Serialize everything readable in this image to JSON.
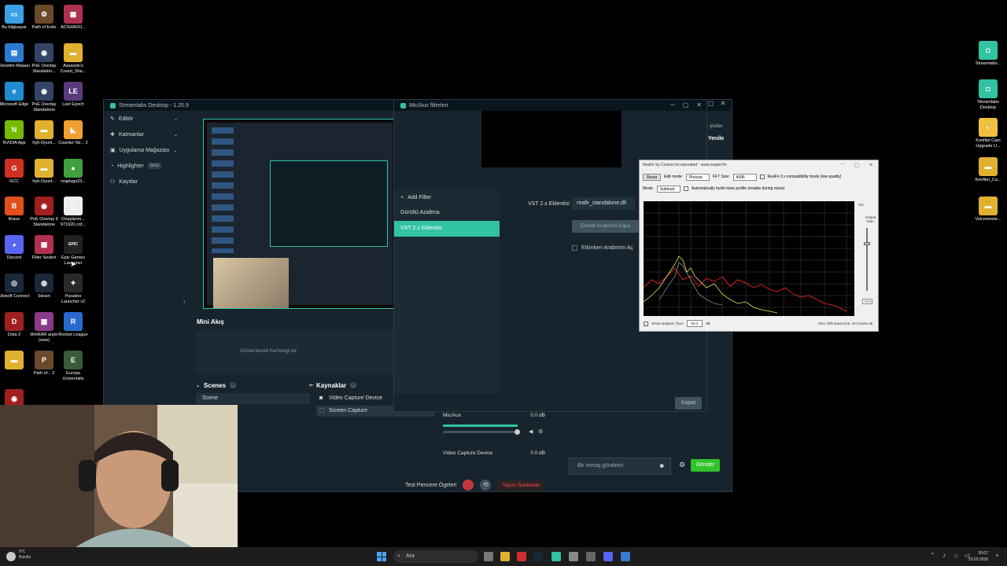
{
  "desktop_left": [
    {
      "label": "Bu bilgisayar",
      "color": "#3aa0e8",
      "glyph": "▭"
    },
    {
      "label": "Path of Exile",
      "color": "#6a4a2a",
      "glyph": "⚙"
    },
    {
      "label": "ACSHADO...",
      "color": "#b03050",
      "glyph": "▦"
    },
    {
      "label": "Denetim Masası",
      "color": "#2b7bd0",
      "glyph": "▤"
    },
    {
      "label": "PoE Overlay Standalon...",
      "color": "#334466",
      "glyph": "◉"
    },
    {
      "label": "Assassin's Creed_Sha...",
      "color": "#e0b030",
      "glyph": "▬"
    },
    {
      "label": "Microsoft Edge",
      "color": "#1f8bd0",
      "glyph": "e"
    },
    {
      "label": "PoE Overlay Standalone",
      "color": "#334466",
      "glyph": "◉"
    },
    {
      "label": "Last Epoch",
      "color": "#5a3a7a",
      "glyph": "LE"
    },
    {
      "label": "NVIDIA App",
      "color": "#76b900",
      "glyph": "N"
    },
    {
      "label": "hylt-Oyunl...",
      "color": "#e0b030",
      "glyph": "▬"
    },
    {
      "label": "Counter-Str... 2",
      "color": "#f0a030",
      "glyph": "◣"
    },
    {
      "label": "GCC",
      "color": "#d03020",
      "glyph": "G"
    },
    {
      "label": "hylt-Oyunl...",
      "color": "#e0b030",
      "glyph": "▬"
    },
    {
      "label": "reaplugs23...",
      "color": "#40a040",
      "glyph": "●"
    },
    {
      "label": "Brave",
      "color": "#e0501c",
      "glyph": "B"
    },
    {
      "label": "PoE Overlay II Standalone",
      "color": "#a02020",
      "glyph": "◉"
    },
    {
      "label": "Onaylanm... 971620.crd...",
      "color": "#eeeeee",
      "glyph": "▯"
    },
    {
      "label": "Discord",
      "color": "#5865f2",
      "glyph": "◕"
    },
    {
      "label": "Filter Sesleri",
      "color": "#b03050",
      "glyph": "▦"
    },
    {
      "label": "Epic Games Launcher",
      "color": "#222222",
      "glyph": "EPIC"
    },
    {
      "label": "Ubisoft Connect",
      "color": "#1a2a3a",
      "glyph": "◎"
    },
    {
      "label": "Steam",
      "color": "#1b2838",
      "glyph": "◍"
    },
    {
      "label": "Paradox Launcher v2",
      "color": "#2a2a2a",
      "glyph": "✦"
    },
    {
      "label": "Dota 2",
      "color": "#a02020",
      "glyph": "D"
    },
    {
      "label": "WinRAR arşivi (new)",
      "color": "#8a3a8a",
      "glyph": "▦"
    },
    {
      "label": "Rocket League",
      "color": "#2a6ad0",
      "glyph": "R"
    },
    {
      "label": "",
      "color": "#e0b030",
      "glyph": "▬"
    },
    {
      "label": "Path of... 2",
      "color": "#6a4a2a",
      "glyph": "P"
    },
    {
      "label": "Europa Universalis",
      "color": "#3a5a3a",
      "glyph": "E"
    },
    {
      "label": "PoE Ov... II Stand...",
      "color": "#a02020",
      "glyph": "◉"
    }
  ],
  "desktop_right": [
    {
      "label": "Streamlabs...",
      "color": "#31c3a2",
      "glyph": "◘"
    },
    {
      "label": "Streamlabs Desktop",
      "color": "#31c3a2",
      "glyph": "◘"
    },
    {
      "label": "Konfitel Cam Upgrade U...",
      "color": "#f0c040",
      "glyph": "◐"
    },
    {
      "label": "Konfitel_Ca...",
      "color": "#e0b030",
      "glyph": "▬"
    },
    {
      "label": "Voicemeete...",
      "color": "#e0b030",
      "glyph": "▬"
    }
  ],
  "streamlabs": {
    "title": "Streamlabs Desktop - 1.20.9",
    "nav": [
      {
        "label": "Editör",
        "icon": "pencil-icon",
        "glyph": "✎",
        "chev": "⌄"
      },
      {
        "label": "Katmanlar",
        "icon": "layers-icon",
        "glyph": "✚",
        "chev": "⌄"
      },
      {
        "label": "Uygulama Mağazası",
        "icon": "store-icon",
        "glyph": "▣",
        "chev": "⌄"
      },
      {
        "label": "Highlighter",
        "icon": "highlighter-icon",
        "glyph": "◔",
        "chev": ""
      },
      {
        "label": "Kayıtlar",
        "icon": "recordings-icon",
        "glyph": "⚇",
        "chev": ""
      }
    ],
    "beta": "beta",
    "mini_akis": "Mini Akış",
    "mini_empty": "Gösterilecek herhangi bir",
    "scenes_title": "Scenes",
    "scene_item": "Scene",
    "sources_title": "Kaynaklar",
    "sources": [
      "Video Capture Device",
      "Screen Capture"
    ],
    "mixer": [
      {
        "name": "Mic/Aux",
        "db": "0.0 dB"
      },
      {
        "name": "Video Capture Device",
        "db": "0.0 dB"
      }
    ],
    "test_label": "Test Pencere Ögeleri",
    "live_label": "Yayını Sonlandır",
    "chat_partial_1": "yiciler",
    "chat_partial_2": "Yenile",
    "chat_placeholder": "Bir mesaj gönderin",
    "send_label": "Gönder"
  },
  "filters": {
    "title": "Mic/Aux filtreleri",
    "add_filter": "Add Filter",
    "items": [
      "Gürültü Azaltma",
      "VST 2.x Eklentisi"
    ],
    "selected": 1,
    "field_label": "VST 2.x Eklentisi",
    "field_value": "reafir_standalone.dll",
    "close_interface": "Eklenti Arabirimi Kapa",
    "active_interface": "Etkinken Arabirimi Aç",
    "close_button": "Kapat"
  },
  "reafir": {
    "title": "ReaFir by Cockos Incorporated - www.reaper.fm",
    "reset": "Reset",
    "edit_mode_label": "Edit mode:",
    "edit_mode": "Precise",
    "fft_label": "FFT Size:",
    "fft_size": "4096",
    "compat": "ReaFir 0.x compatibility mode (low quality)",
    "mode_label": "Mode:",
    "mode": "Subtract",
    "auto_build": "Automatically build noise profile (enable during noise)",
    "show_floor": "Show analysis, floor:",
    "floor_value": "-90.0",
    "floor_unit": "dB",
    "hint": "Hint: shift draws line, ctrl moves all",
    "output_gain": "Output Gain",
    "gain_value": "+0.0",
    "gain_scale": [
      "+24",
      "+12",
      "0",
      "-12",
      "-24",
      "-36",
      "-48",
      "-60",
      "-72",
      "-84",
      "-96"
    ],
    "x_ticks": [
      "80",
      "150",
      "200",
      "300",
      "500",
      "1.0k",
      "2.0k",
      "3.0k",
      "5.0k",
      "10k",
      "20k"
    ]
  },
  "taskbar": {
    "weather_temp": "9°C",
    "weather_desc": "Bulutlu",
    "search": "Ara",
    "time": "20:07",
    "date": "23.03.2026"
  }
}
